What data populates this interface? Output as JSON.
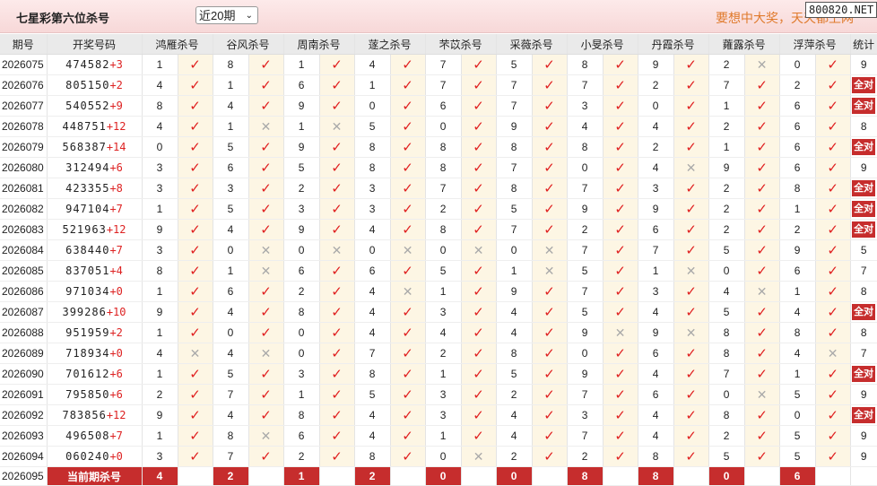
{
  "header": {
    "title": "七星彩第六位杀号",
    "period_select": "近20期",
    "slogan": "要想中大奖，天天都上网",
    "site_badge": "800820.NET"
  },
  "columns": [
    "期号",
    "开奖号码",
    "鸿雁杀号",
    "谷风杀号",
    "周南杀号",
    "蓫之杀号",
    "芣苡杀号",
    "采薇杀号",
    "小旻杀号",
    "丹霞杀号",
    "蕹露杀号",
    "浮萍杀号",
    "统计"
  ],
  "rows": [
    {
      "issue": "2026075",
      "draw": "474582",
      "sum": "+3",
      "kills": [
        "1",
        "8",
        "1",
        "4",
        "7",
        "5",
        "8",
        "9",
        "2",
        "0"
      ],
      "hits": [
        true,
        true,
        true,
        true,
        true,
        true,
        true,
        true,
        false,
        true
      ],
      "stat": "9"
    },
    {
      "issue": "2026076",
      "draw": "805150",
      "sum": "+2",
      "kills": [
        "4",
        "1",
        "6",
        "1",
        "7",
        "7",
        "7",
        "2",
        "7",
        "2"
      ],
      "hits": [
        true,
        true,
        true,
        true,
        true,
        true,
        true,
        true,
        true,
        true
      ],
      "stat": "全对"
    },
    {
      "issue": "2026077",
      "draw": "540552",
      "sum": "+9",
      "kills": [
        "8",
        "4",
        "9",
        "0",
        "6",
        "7",
        "3",
        "0",
        "1",
        "6"
      ],
      "hits": [
        true,
        true,
        true,
        true,
        true,
        true,
        true,
        true,
        true,
        true
      ],
      "stat": "全对"
    },
    {
      "issue": "2026078",
      "draw": "448751",
      "sum": "+12",
      "kills": [
        "4",
        "1",
        "1",
        "5",
        "0",
        "9",
        "4",
        "4",
        "2",
        "6"
      ],
      "hits": [
        true,
        false,
        false,
        true,
        true,
        true,
        true,
        true,
        true,
        true
      ],
      "stat": "8"
    },
    {
      "issue": "2026079",
      "draw": "568387",
      "sum": "+14",
      "kills": [
        "0",
        "5",
        "9",
        "8",
        "8",
        "8",
        "8",
        "2",
        "1",
        "6"
      ],
      "hits": [
        true,
        true,
        true,
        true,
        true,
        true,
        true,
        true,
        true,
        true
      ],
      "stat": "全对"
    },
    {
      "issue": "2026080",
      "draw": "312494",
      "sum": "+6",
      "kills": [
        "3",
        "6",
        "5",
        "8",
        "8",
        "7",
        "0",
        "4",
        "9",
        "6"
      ],
      "hits": [
        true,
        true,
        true,
        true,
        true,
        true,
        true,
        false,
        true,
        true
      ],
      "stat": "9"
    },
    {
      "issue": "2026081",
      "draw": "423355",
      "sum": "+8",
      "kills": [
        "3",
        "3",
        "2",
        "3",
        "7",
        "8",
        "7",
        "3",
        "2",
        "8"
      ],
      "hits": [
        true,
        true,
        true,
        true,
        true,
        true,
        true,
        true,
        true,
        true
      ],
      "stat": "全对"
    },
    {
      "issue": "2026082",
      "draw": "947104",
      "sum": "+7",
      "kills": [
        "1",
        "5",
        "3",
        "3",
        "2",
        "5",
        "9",
        "9",
        "2",
        "1"
      ],
      "hits": [
        true,
        true,
        true,
        true,
        true,
        true,
        true,
        true,
        true,
        true
      ],
      "stat": "全对"
    },
    {
      "issue": "2026083",
      "draw": "521963",
      "sum": "+12",
      "kills": [
        "9",
        "4",
        "9",
        "4",
        "8",
        "7",
        "2",
        "6",
        "2",
        "2"
      ],
      "hits": [
        true,
        true,
        true,
        true,
        true,
        true,
        true,
        true,
        true,
        true
      ],
      "stat": "全对"
    },
    {
      "issue": "2026084",
      "draw": "638440",
      "sum": "+7",
      "kills": [
        "3",
        "0",
        "0",
        "0",
        "0",
        "0",
        "7",
        "7",
        "5",
        "9"
      ],
      "hits": [
        true,
        false,
        false,
        false,
        false,
        false,
        true,
        true,
        true,
        true
      ],
      "stat": "5"
    },
    {
      "issue": "2026085",
      "draw": "837051",
      "sum": "+4",
      "kills": [
        "8",
        "1",
        "6",
        "6",
        "5",
        "1",
        "5",
        "1",
        "0",
        "6"
      ],
      "hits": [
        true,
        false,
        true,
        true,
        true,
        false,
        true,
        false,
        true,
        true
      ],
      "stat": "7"
    },
    {
      "issue": "2026086",
      "draw": "971034",
      "sum": "+0",
      "kills": [
        "1",
        "6",
        "2",
        "4",
        "1",
        "9",
        "7",
        "3",
        "4",
        "1"
      ],
      "hits": [
        true,
        true,
        true,
        false,
        true,
        true,
        true,
        true,
        false,
        true
      ],
      "stat": "8"
    },
    {
      "issue": "2026087",
      "draw": "399286",
      "sum": "+10",
      "kills": [
        "9",
        "4",
        "8",
        "4",
        "3",
        "4",
        "5",
        "4",
        "5",
        "4"
      ],
      "hits": [
        true,
        true,
        true,
        true,
        true,
        true,
        true,
        true,
        true,
        true
      ],
      "stat": "全对"
    },
    {
      "issue": "2026088",
      "draw": "951959",
      "sum": "+2",
      "kills": [
        "1",
        "0",
        "0",
        "4",
        "4",
        "4",
        "9",
        "9",
        "8",
        "8"
      ],
      "hits": [
        true,
        true,
        true,
        true,
        true,
        true,
        false,
        false,
        true,
        true
      ],
      "stat": "8"
    },
    {
      "issue": "2026089",
      "draw": "718934",
      "sum": "+0",
      "kills": [
        "4",
        "4",
        "0",
        "7",
        "2",
        "8",
        "0",
        "6",
        "8",
        "4"
      ],
      "hits": [
        false,
        false,
        true,
        true,
        true,
        true,
        true,
        true,
        true,
        false
      ],
      "stat": "7"
    },
    {
      "issue": "2026090",
      "draw": "701612",
      "sum": "+6",
      "kills": [
        "1",
        "5",
        "3",
        "8",
        "1",
        "5",
        "9",
        "4",
        "7",
        "1"
      ],
      "hits": [
        true,
        true,
        true,
        true,
        true,
        true,
        true,
        true,
        true,
        true
      ],
      "stat": "全对"
    },
    {
      "issue": "2026091",
      "draw": "795850",
      "sum": "+6",
      "kills": [
        "2",
        "7",
        "1",
        "5",
        "3",
        "2",
        "7",
        "6",
        "0",
        "5"
      ],
      "hits": [
        true,
        true,
        true,
        true,
        true,
        true,
        true,
        true,
        false,
        true
      ],
      "stat": "9"
    },
    {
      "issue": "2026092",
      "draw": "783856",
      "sum": "+12",
      "kills": [
        "9",
        "4",
        "8",
        "4",
        "3",
        "4",
        "3",
        "4",
        "8",
        "0"
      ],
      "hits": [
        true,
        true,
        true,
        true,
        true,
        true,
        true,
        true,
        true,
        true
      ],
      "stat": "全对"
    },
    {
      "issue": "2026093",
      "draw": "496508",
      "sum": "+7",
      "kills": [
        "1",
        "8",
        "6",
        "4",
        "1",
        "4",
        "7",
        "4",
        "2",
        "5"
      ],
      "hits": [
        true,
        false,
        true,
        true,
        true,
        true,
        true,
        true,
        true,
        true
      ],
      "stat": "9"
    },
    {
      "issue": "2026094",
      "draw": "060240",
      "sum": "+0",
      "kills": [
        "3",
        "7",
        "2",
        "8",
        "0",
        "2",
        "2",
        "8",
        "5",
        "5"
      ],
      "hits": [
        true,
        true,
        true,
        true,
        false,
        true,
        true,
        true,
        true,
        true
      ],
      "stat": "9"
    }
  ],
  "current": {
    "issue": "2026095",
    "label": "当前期杀号",
    "kills": [
      "4",
      "2",
      "1",
      "2",
      "0",
      "0",
      "8",
      "8",
      "0",
      "6"
    ]
  },
  "colors": {
    "hit": "#e02020",
    "miss": "#aaaaaa",
    "accent": "#c62d2d",
    "mark_bg": "#fdf6e4"
  },
  "icons": {
    "hit": "check-icon",
    "miss": "cross-icon"
  }
}
